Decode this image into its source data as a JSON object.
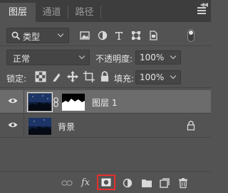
{
  "tabs": [
    {
      "label": "图层",
      "active": true
    },
    {
      "label": "通道",
      "active": false
    },
    {
      "label": "路径",
      "active": false
    }
  ],
  "filter": {
    "kind_label": "类型",
    "icons": [
      "image-filter-icon",
      "adjustment-filter-icon",
      "type-filter-icon",
      "shape-filter-icon",
      "smart-object-filter-icon"
    ]
  },
  "blend": {
    "mode": "正常",
    "opacity_label": "不透明度:",
    "opacity_value": "100%"
  },
  "lock": {
    "label": "锁定:",
    "fill_label": "填充:",
    "fill_value": "100%"
  },
  "layers": [
    {
      "name": "图层 1",
      "visible": true,
      "selected": true,
      "has_mask": true
    },
    {
      "name": "背景",
      "visible": true,
      "selected": false,
      "locked": true
    }
  ],
  "bottom_icons": [
    "link-icon",
    "fx-icon",
    "add-mask-icon",
    "adjustment-layer-icon",
    "group-folder-icon",
    "new-layer-icon",
    "trash-icon"
  ],
  "bottom": {
    "fx": "fx"
  },
  "colors": {
    "panel_bg": "#535353",
    "tab_bar": "#3d3d3d",
    "selected_layer": "#6c6c6c",
    "highlight_box": "#e5312f"
  }
}
